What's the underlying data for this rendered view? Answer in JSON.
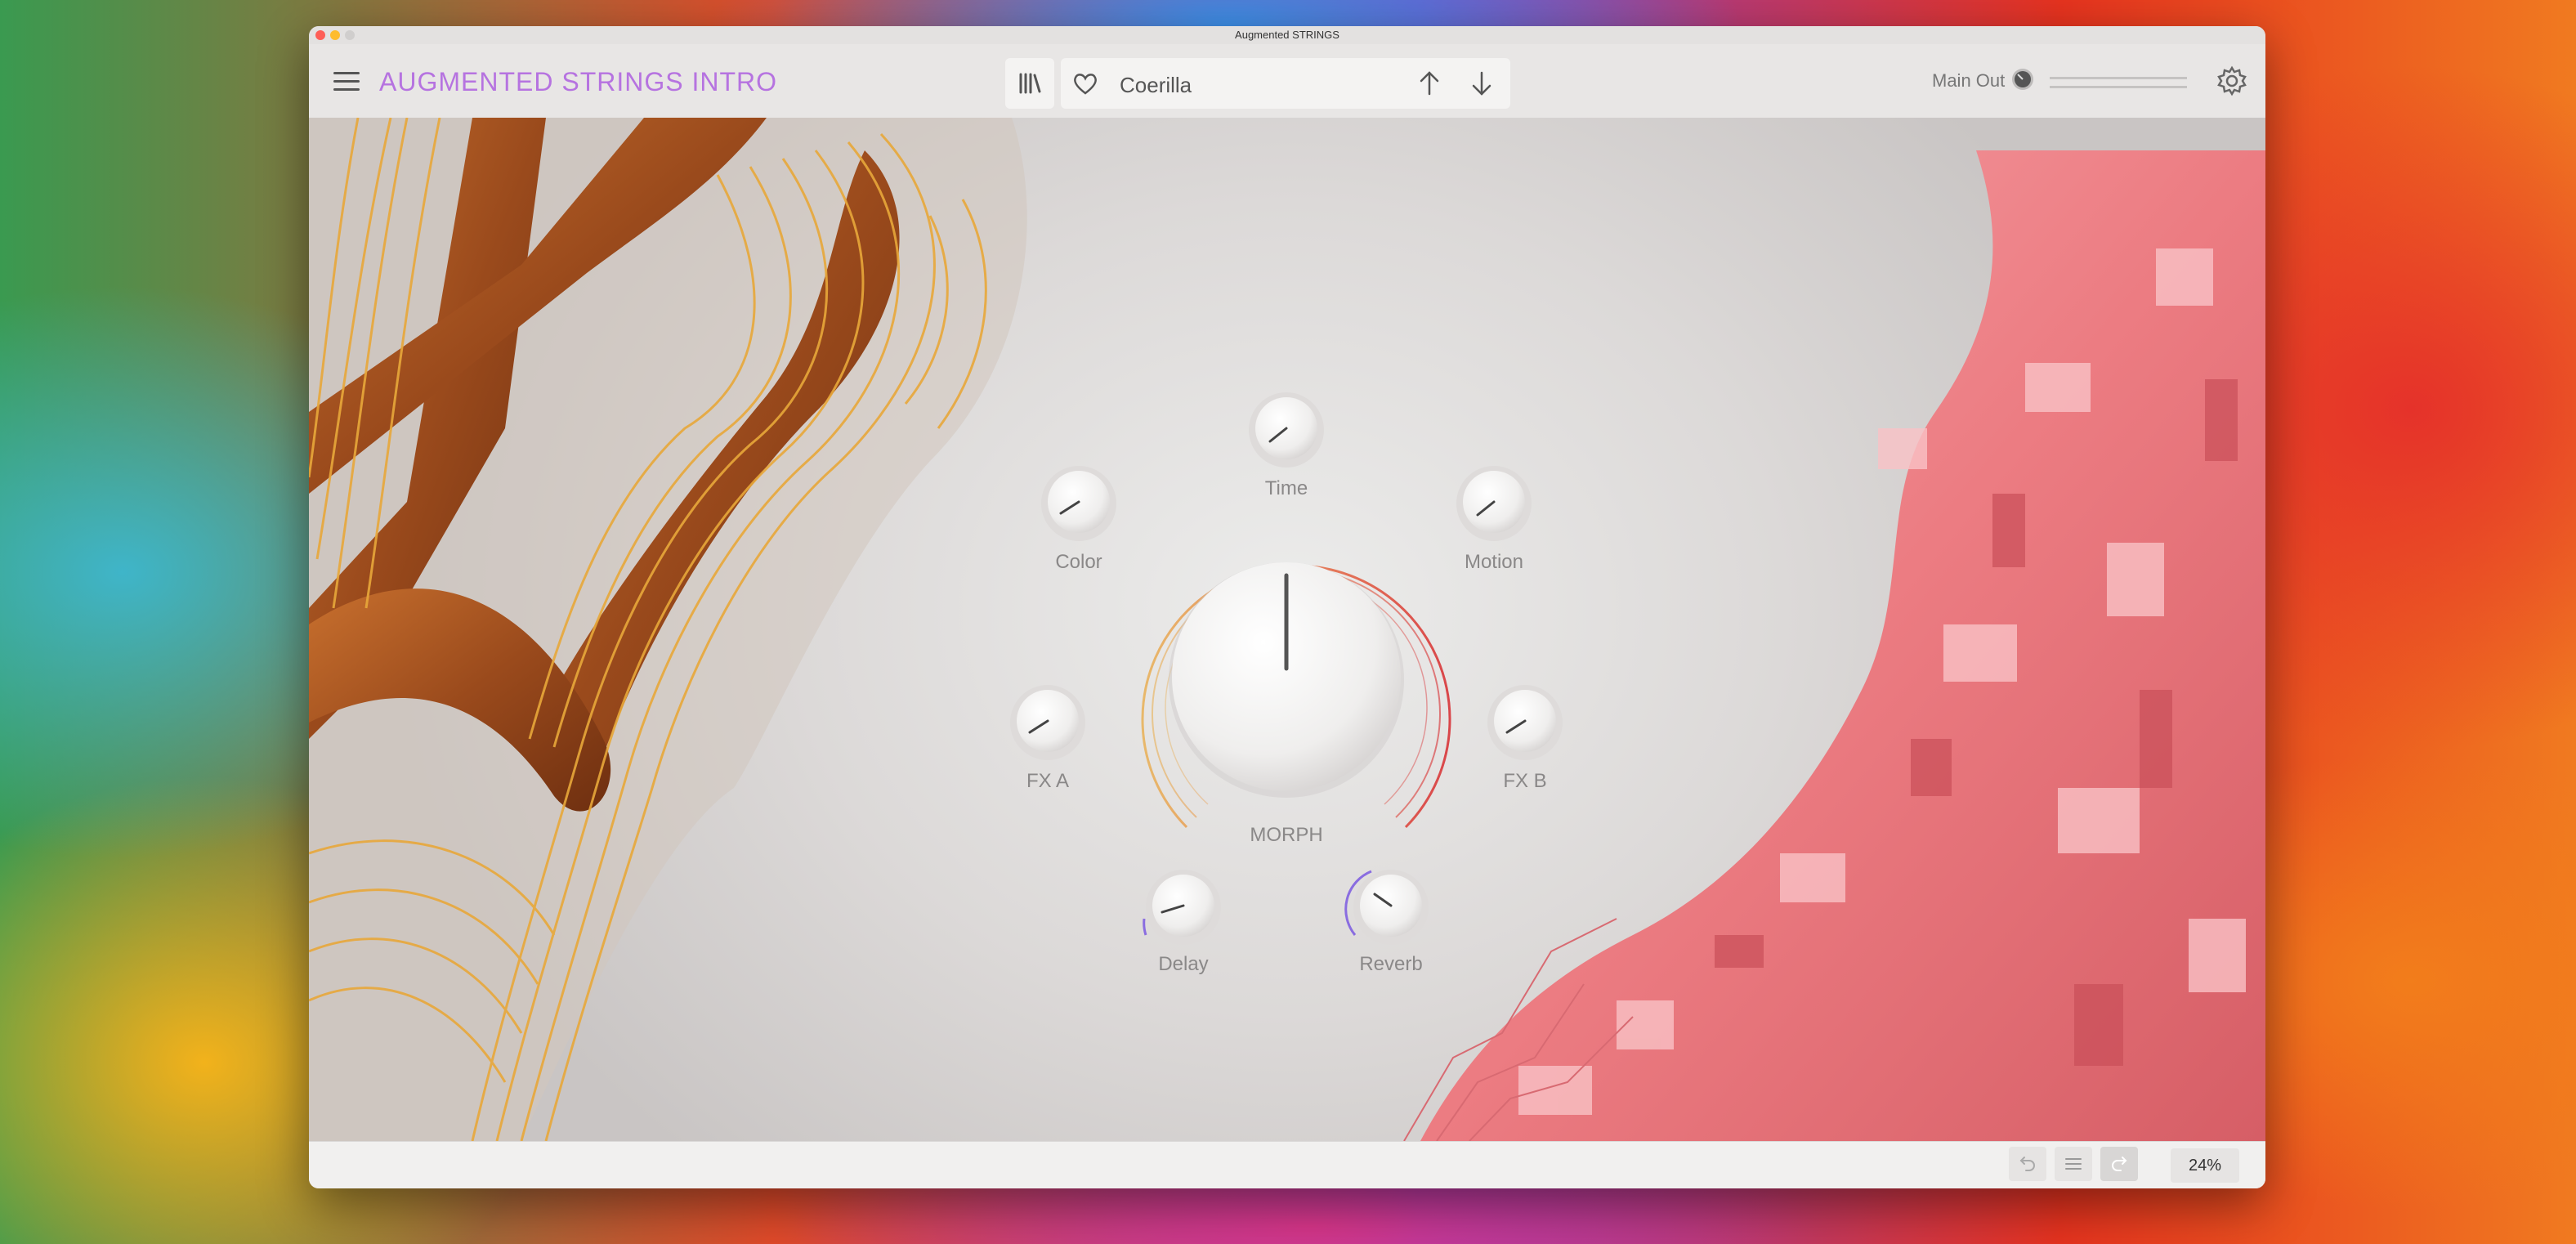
{
  "window": {
    "title": "Augmented STRINGS"
  },
  "toolbar": {
    "app_title": "AUGMENTED STRINGS INTRO",
    "preset_name": "Coerilla",
    "main_out_label": "Main Out"
  },
  "controls": {
    "time_label": "Time",
    "color_label": "Color",
    "motion_label": "Motion",
    "morph_label": "MORPH",
    "fx_a_label": "FX A",
    "fx_b_label": "FX B",
    "delay_label": "Delay",
    "reverb_label": "Reverb"
  },
  "statusbar": {
    "zoom": "24%"
  },
  "colors": {
    "accent": "#b673e0",
    "morph_arc_start": "#e8b86a",
    "morph_arc_end": "#d9464a",
    "fx_arc": "#8a6de0"
  },
  "icons": [
    "hamburger-icon",
    "library-icon",
    "heart-icon",
    "arrow-up-icon",
    "arrow-down-icon",
    "volume-knob-icon",
    "gear-icon",
    "undo-icon",
    "list-icon",
    "redo-icon"
  ]
}
